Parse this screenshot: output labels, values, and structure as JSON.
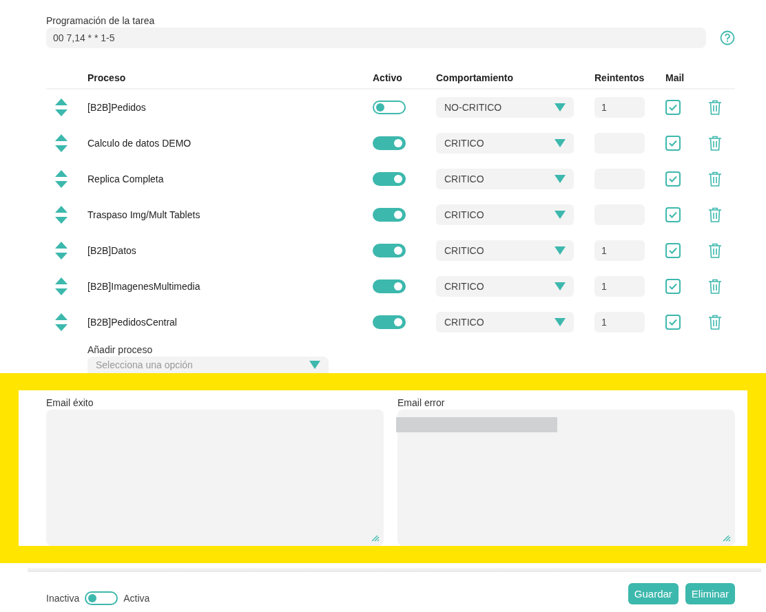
{
  "schedule": {
    "label": "Programación de la tarea",
    "value": "00 7,14 * * 1-5"
  },
  "table": {
    "columns": [
      "Proceso",
      "Activo",
      "Comportamiento",
      "Reintentos",
      "Mail"
    ],
    "rows": [
      {
        "name": "[B2B]Pedidos",
        "active": false,
        "behavior": "NO-CRITICO",
        "retries": "1",
        "mail": true
      },
      {
        "name": "Calculo de datos DEMO",
        "active": true,
        "behavior": "CRITICO",
        "mail": true
      },
      {
        "name": "Replica Completa",
        "active": true,
        "behavior": "CRITICO",
        "mail": true
      },
      {
        "name": "Traspaso Img/Mult Tablets",
        "active": true,
        "behavior": "CRITICO",
        "mail": true
      },
      {
        "name": "[B2B]Datos",
        "active": true,
        "behavior": "CRITICO",
        "retries": "1",
        "mail": true
      },
      {
        "name": "[B2B]ImagenesMultimedia",
        "active": true,
        "behavior": "CRITICO",
        "retries": "1",
        "mail": true
      },
      {
        "name": "[B2B]PedidosCentral",
        "active": true,
        "behavior": "CRITICO",
        "retries": "1",
        "mail": true
      }
    ]
  },
  "add_process": {
    "label": "Añadir proceso",
    "placeholder": "Selecciona una opción"
  },
  "emails": [
    {
      "label": "Email éxito",
      "redacted": false
    },
    {
      "label": "Email error",
      "redacted": true
    }
  ],
  "footer": {
    "off_label": "Inactiva",
    "on_label": "Activa",
    "on": false,
    "buttons": [
      "Guardar",
      "Eliminar"
    ]
  }
}
